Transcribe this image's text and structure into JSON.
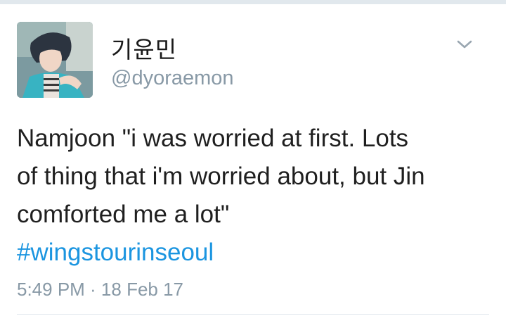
{
  "tweet": {
    "display_name": "기윤민",
    "handle": "@dyoraemon",
    "text_lines": [
      "Namjoon \"i was worried at first. Lots",
      "of thing that i'm worried about, but Jin",
      "comforted me a lot\""
    ],
    "hashtag": "#wingstourinseoul",
    "timestamp": "5:49 PM · 18 Feb 17"
  },
  "icons": {
    "avatar": "avatar-photo",
    "menu": "chevron-down-icon"
  },
  "colors": {
    "hashtag": "#1b95e0",
    "secondary_text": "#8899a6",
    "primary_text": "#1f1f1f",
    "divider": "#e1e8ed"
  }
}
